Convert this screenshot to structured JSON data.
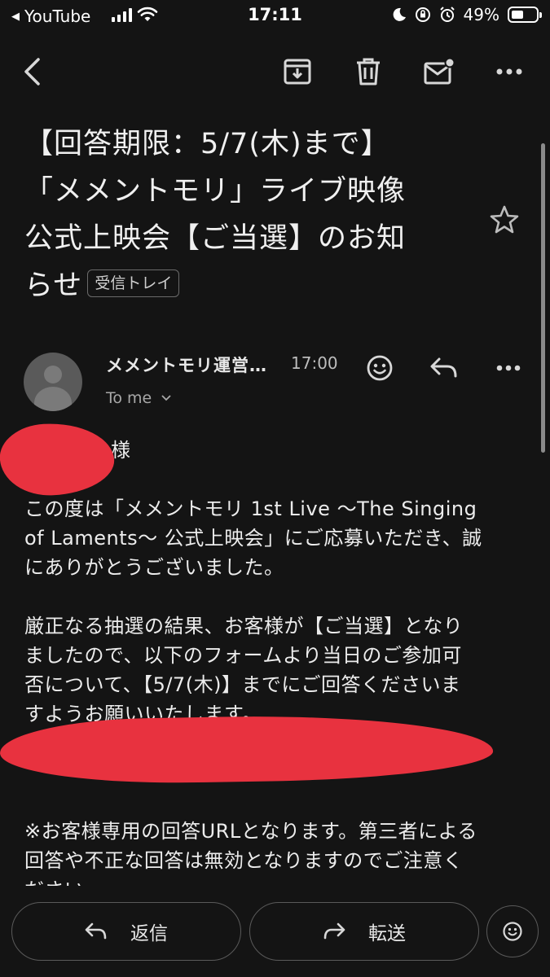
{
  "status_bar": {
    "back_app": "YouTube",
    "time": "17:11",
    "battery_percent": "49%",
    "battery_level": 0.49
  },
  "toolbar": {
    "icons": [
      "back-arrow-icon",
      "archive-icon",
      "trash-icon",
      "mark-unread-icon",
      "more-horizontal-icon"
    ]
  },
  "email": {
    "subject_lines": [
      "【回答期限：5/7(木)まで】",
      "「メメントモリ」ライブ映像",
      "公式上映会【ご当選】のお知",
      "らせ"
    ],
    "label": "受信トレイ",
    "sender": "メメントモリ運営…",
    "time": "17:00",
    "recipient": "To me",
    "body": {
      "salutation": "様",
      "p1": [
        "この度は「メメントモリ 1st Live 〜The Singing",
        "of Laments〜 公式上映会」にご応募いただき、誠",
        "にありがとうございました。"
      ],
      "p2": [
        "厳正なる抽選の結果、お客様が【ご当選】となり",
        "ましたので、以下のフォームより当日のご参加可",
        "否について、【5/7(木)】までにご回答くださいま",
        "すようお願いいたします。"
      ],
      "p3": [
        "※お客様専用の回答URLとなります。第三者による",
        "回答や不正な回答は無効となりますのでご注意く",
        "ださい。"
      ]
    }
  },
  "bottom_bar": {
    "reply_label": "返信",
    "forward_label": "転送"
  },
  "colors": {
    "background": "#141414",
    "redaction": "#e8323f"
  }
}
